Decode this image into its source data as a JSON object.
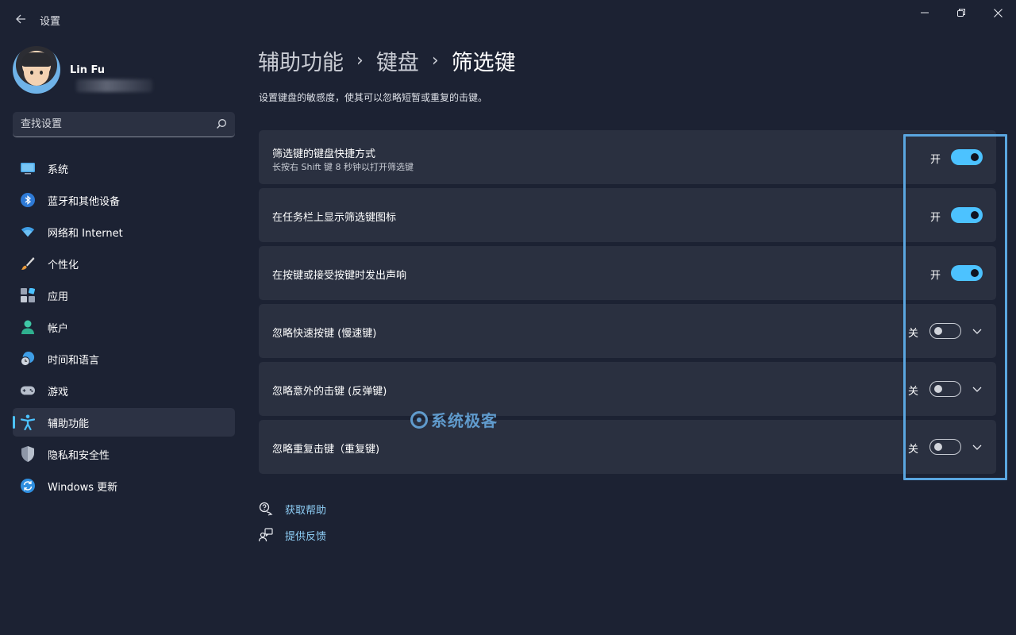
{
  "app": {
    "title": "设置"
  },
  "user": {
    "name": "Lin Fu"
  },
  "search": {
    "placeholder": "查找设置"
  },
  "nav": [
    {
      "label": "系统",
      "icon": "monitor-icon"
    },
    {
      "label": "蓝牙和其他设备",
      "icon": "bluetooth-icon"
    },
    {
      "label": "网络和 Internet",
      "icon": "wifi-icon"
    },
    {
      "label": "个性化",
      "icon": "brush-icon"
    },
    {
      "label": "应用",
      "icon": "apps-icon"
    },
    {
      "label": "帐户",
      "icon": "account-icon"
    },
    {
      "label": "时间和语言",
      "icon": "globe-clock-icon"
    },
    {
      "label": "游戏",
      "icon": "gamepad-icon"
    },
    {
      "label": "辅助功能",
      "icon": "accessibility-icon",
      "active": true
    },
    {
      "label": "隐私和安全性",
      "icon": "shield-icon"
    },
    {
      "label": "Windows 更新",
      "icon": "update-icon"
    }
  ],
  "breadcrumb": {
    "level1": "辅助功能",
    "level2": "键盘",
    "current": "筛选键"
  },
  "description": "设置键盘的敏感度，使其可以忽略短暂或重复的击键。",
  "settings": [
    {
      "title": "筛选键的键盘快捷方式",
      "subtitle": "长按右 Shift 键 8 秒钟以打开筛选键",
      "state": "开",
      "on": true,
      "expandable": false
    },
    {
      "title": "在任务栏上显示筛选键图标",
      "state": "开",
      "on": true,
      "expandable": false
    },
    {
      "title": "在按键或接受按键时发出声响",
      "state": "开",
      "on": true,
      "expandable": false
    },
    {
      "title": "忽略快速按键 (慢速键)",
      "state": "关",
      "on": false,
      "expandable": true
    },
    {
      "title": "忽略意外的击键 (反弹键)",
      "state": "关",
      "on": false,
      "expandable": true
    },
    {
      "title": "忽略重复击键（重复键)",
      "state": "关",
      "on": false,
      "expandable": true
    }
  ],
  "watermark": "系统极客",
  "help": {
    "get_help": "获取帮助",
    "feedback": "提供反馈"
  },
  "colors": {
    "accent": "#4cc2ff",
    "background": "#1c2233",
    "card": "#2a3040",
    "link": "#8fcff7",
    "highlight": "#5aa6e0"
  }
}
